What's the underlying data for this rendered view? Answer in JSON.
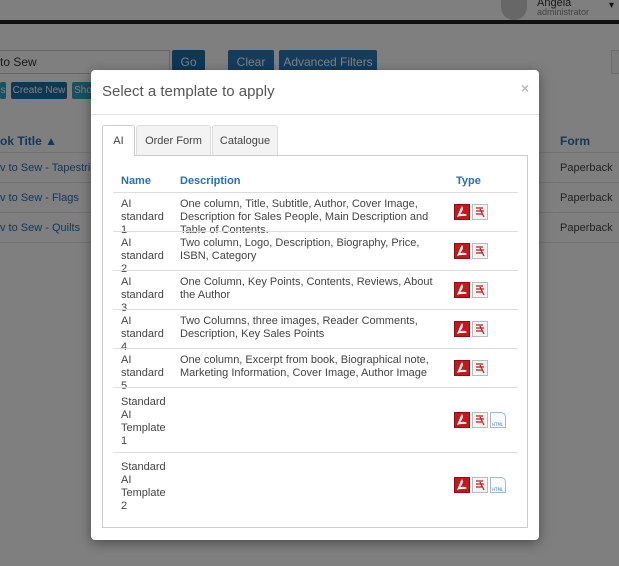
{
  "user": {
    "name": "Angela",
    "role": "administrator"
  },
  "search": {
    "value": "to Sew"
  },
  "buttons": {
    "go": "Go",
    "clear": "Clear",
    "advanced_filters": "Advanced Filters",
    "small1": "s",
    "create_new": "Create New",
    "small3": "Sho"
  },
  "list": {
    "col_title": "ok Title ▲",
    "col_form": "Form",
    "rows": [
      {
        "title": "v to Sew - Flags",
        "form": "Paperback"
      },
      {
        "title": "v to Sew - Quilts",
        "form": "Paperback"
      },
      {
        "title": "v to Sew - Tapestries",
        "form": "Paperback"
      }
    ]
  },
  "modal": {
    "title": "Select a template to apply",
    "close": "×",
    "tabs": [
      {
        "label": "AI",
        "active": true
      },
      {
        "label": "Order Form",
        "active": false
      },
      {
        "label": "Catalogue",
        "active": false
      }
    ],
    "table": {
      "headers": {
        "name": "Name",
        "description": "Description",
        "type": "Type"
      },
      "rows": [
        {
          "name": "AI standard 1",
          "description": "One column, Title, Subtitle, Author, Cover Image, Description for Sales People, Main Description and Table of Contents.",
          "types": [
            "pdf-icon",
            "doc-icon"
          ]
        },
        {
          "name": "AI standard 2",
          "description": "Two column, Logo, Description, Biography, Price, ISBN, Category",
          "types": [
            "pdf-icon",
            "doc-icon"
          ]
        },
        {
          "name": "AI standard 3",
          "description": "One Column, Key Points, Contents, Reviews, About the Author",
          "types": [
            "pdf-icon",
            "doc-icon"
          ]
        },
        {
          "name": "AI standard 4",
          "description": "Two Columns, three images, Reader Comments, Description, Key Sales Points",
          "types": [
            "pdf-icon",
            "doc-icon"
          ]
        },
        {
          "name": "AI standard 5",
          "description": "One column, Excerpt from book, Biographical note, Marketing Information, Cover Image, Author Image",
          "types": [
            "pdf-icon",
            "doc-icon"
          ]
        },
        {
          "name": "Standard AI Template 1",
          "description": "",
          "types": [
            "pdf-icon",
            "doc-icon",
            "html-icon"
          ]
        },
        {
          "name": "Standard AI Template 2",
          "description": "",
          "types": [
            "pdf-icon",
            "doc-icon",
            "html-icon"
          ]
        }
      ]
    },
    "html_icon_text": "HTML"
  },
  "colors": {
    "primary": "#2a78b6",
    "link": "#2a6fb0",
    "pdf": "#c8171a",
    "info": "#2ba4c4"
  }
}
